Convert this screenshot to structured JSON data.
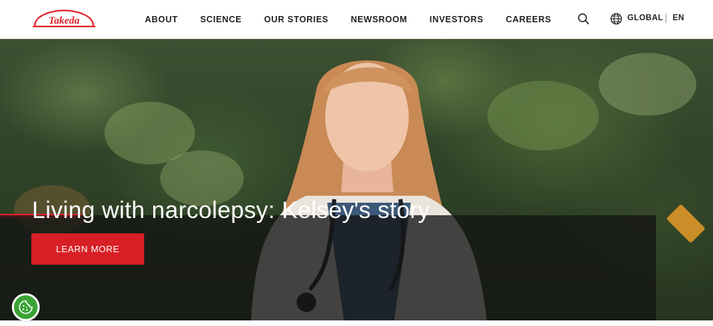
{
  "brand": {
    "logo_text": "Takeda",
    "accent_color": "#e1242a"
  },
  "nav": {
    "items": [
      {
        "label": "ABOUT"
      },
      {
        "label": "SCIENCE"
      },
      {
        "label": "OUR STORIES"
      },
      {
        "label": "NEWSROOM"
      },
      {
        "label": "INVESTORS"
      },
      {
        "label": "CAREERS"
      }
    ]
  },
  "utilities": {
    "search_icon": "search-icon",
    "globe_icon": "globe-icon",
    "region_label": "GLOBAL",
    "language_label": "EN"
  },
  "hero": {
    "headline": "Living with narcolepsy: Kelsey's story",
    "cta_label": "LEARN MORE",
    "cta_color": "#d81f26"
  },
  "cookie_widget": {
    "icon": "cookie-icon",
    "color": "#3aa335"
  }
}
